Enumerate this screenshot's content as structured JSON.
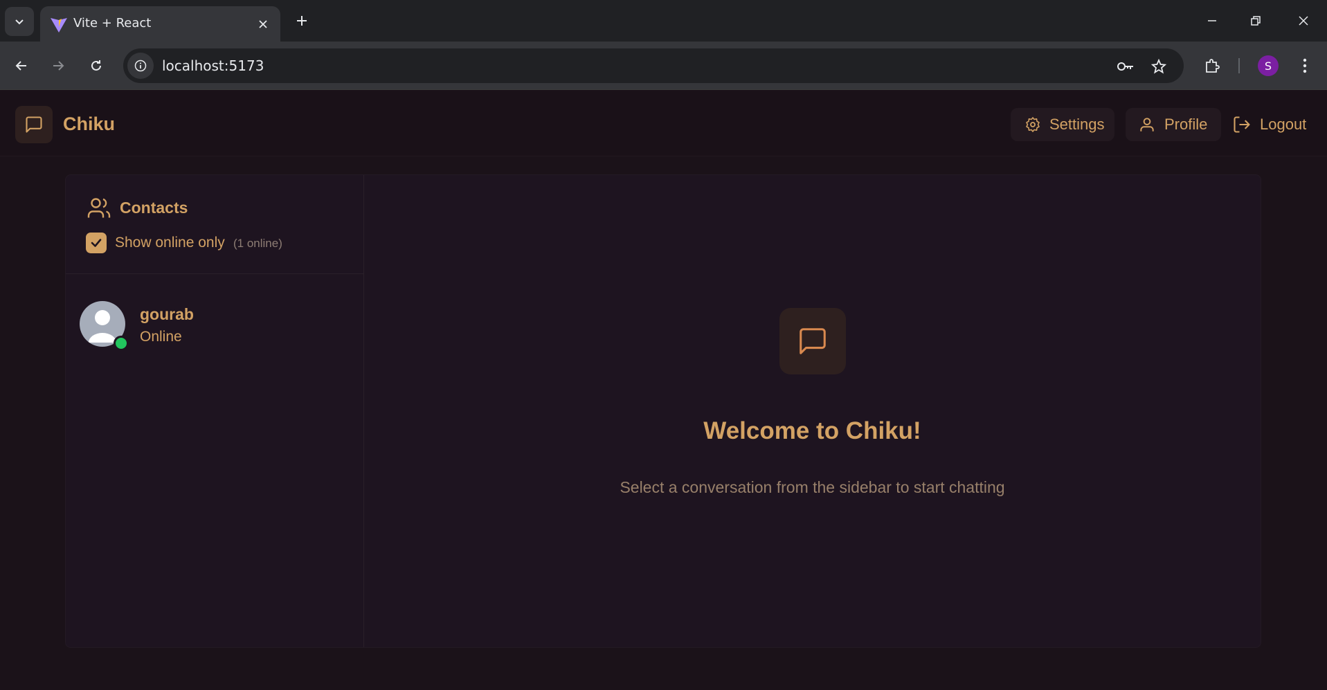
{
  "browser": {
    "tab": {
      "title": "Vite + React"
    },
    "url": "localhost:5173",
    "profile_initial": "S"
  },
  "app": {
    "brand": "Chiku",
    "nav": {
      "settings": "Settings",
      "profile": "Profile",
      "logout": "Logout"
    },
    "accent_color": "#d3a264",
    "online_color": "#22c55e"
  },
  "sidebar": {
    "title": "Contacts",
    "filter": {
      "label": "Show online only",
      "checked": true,
      "online_count": "(1 online)"
    },
    "contacts": [
      {
        "name": "gourab",
        "status": "Online"
      }
    ]
  },
  "welcome": {
    "title": "Welcome to Chiku!",
    "subtitle": "Select a conversation from the sidebar to start chatting"
  }
}
